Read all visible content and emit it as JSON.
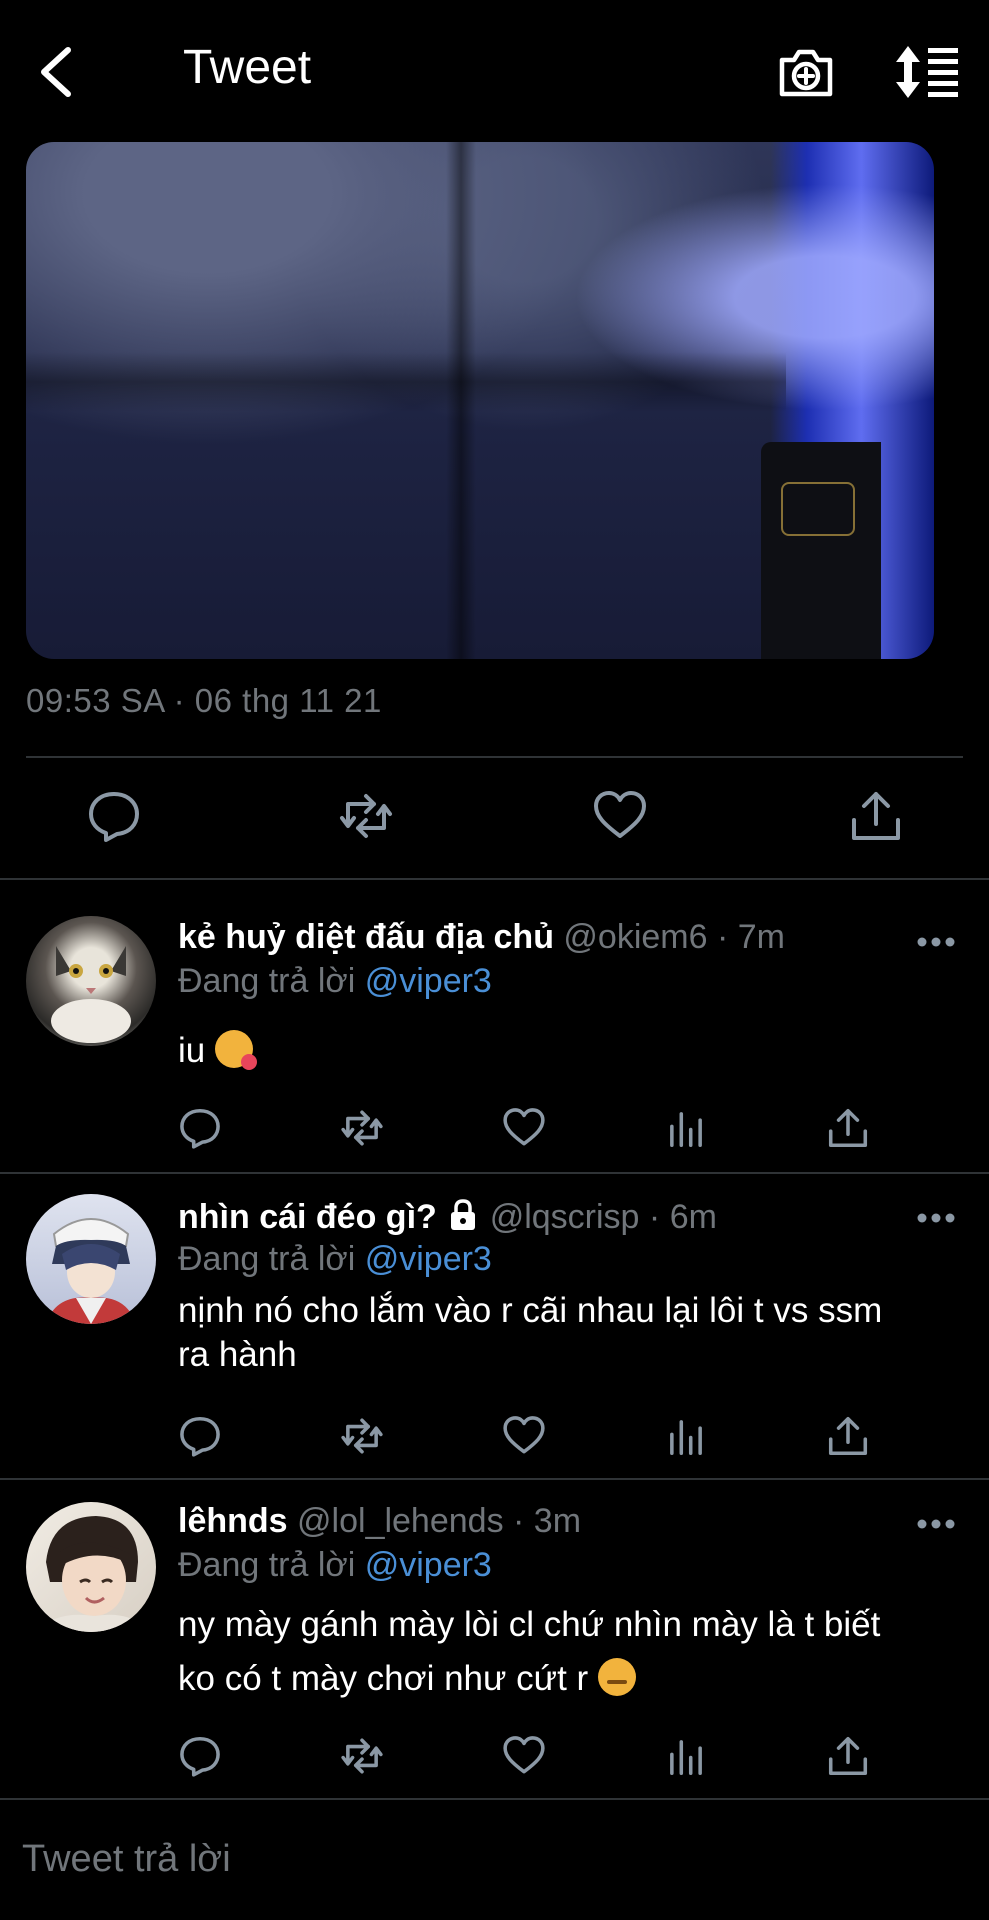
{
  "header": {
    "title": "Tweet",
    "back_icon": "chevron-left-icon",
    "camera_icon": "camera-plus-icon",
    "sort_icon": "sort-list-icon"
  },
  "tweet": {
    "timestamp": "09:53 SA · 06 thg 11 21"
  },
  "replies": [
    {
      "name": "kẻ huỷ diệt đấu địa chủ",
      "handle": "@okiem6",
      "time": "· 7m",
      "replying_prefix": "Đang trả lời",
      "replying_to": "@viper3",
      "text": "iu",
      "emoji": "smiling-face-with-hearts",
      "locked": false
    },
    {
      "name": "nhìn cái đéo gì?",
      "handle": "@lqscrisp",
      "time": "· 6m",
      "replying_prefix": "Đang trả lời",
      "replying_to": "@viper3",
      "text_lines": [
        "nịnh nó cho lắm vào r cãi nhau lại lôi t vs ssm",
        "ra hành"
      ],
      "locked": true
    },
    {
      "name": "lêhnds",
      "handle": "@lol_lehends",
      "time": "· 3m",
      "replying_prefix": "Đang trả lời",
      "replying_to": "@viper3",
      "text_lines": [
        "ny mày gánh mày lòi cl chứ nhìn mày là t biết",
        "ko có t mày chơi như cứt r"
      ],
      "emoji": "smirking-face",
      "locked": false
    }
  ],
  "compose": {
    "placeholder": "Tweet trả lời"
  },
  "colors": {
    "background": "#000000",
    "text": "#e7e9ea",
    "muted": "#71767b",
    "link": "#4a8fd6",
    "divider": "#2f3336"
  }
}
